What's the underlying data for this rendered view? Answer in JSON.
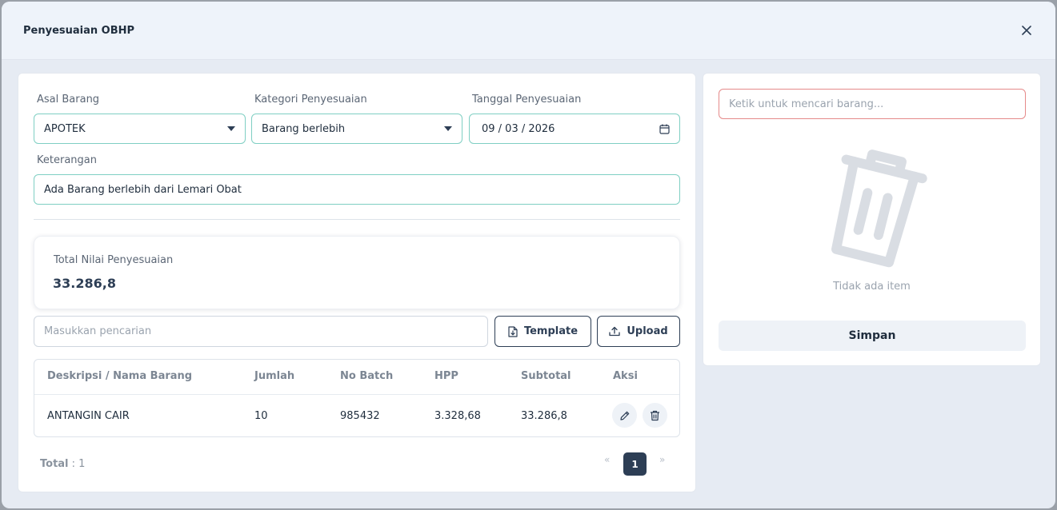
{
  "modal": {
    "title": "Penyesuaian OBHP",
    "close_icon": "close-icon"
  },
  "form": {
    "asal_barang": {
      "label": "Asal Barang",
      "value": "APOTEK"
    },
    "kategori": {
      "label": "Kategori Penyesuaian",
      "value": "Barang berlebih"
    },
    "tanggal": {
      "label": "Tanggal Penyesuaian",
      "value": "09 / 03 / 2026"
    },
    "keterangan": {
      "label": "Keterangan",
      "value": "Ada Barang berlebih dari Lemari Obat"
    }
  },
  "summary": {
    "label": "Total Nilai Penyesuaian",
    "value": "33.286,8"
  },
  "toolbar": {
    "search_placeholder": "Masukkan pencarian",
    "template_label": "Template",
    "upload_label": "Upload"
  },
  "table": {
    "headers": [
      "Deskripsi / Nama Barang",
      "Jumlah",
      "No Batch",
      "HPP",
      "Subtotal",
      "Aksi"
    ],
    "rows": [
      {
        "nama": "ANTANGIN CAIR",
        "jumlah": "10",
        "batch": "985432",
        "hpp": "3.328,68",
        "subtotal": "33.286,8"
      }
    ]
  },
  "footer": {
    "total_label": "Total",
    "total_value": ": 1",
    "prev": "«",
    "page": "1",
    "next": "»"
  },
  "right": {
    "search_placeholder": "Ketik untuk mencari barang...",
    "empty_text": "Tidak ada item",
    "save_label": "Simpan"
  },
  "colors": {
    "accent": "#2d3e55",
    "field_border": "#7fcfc3",
    "error_border": "#e58a8a"
  }
}
